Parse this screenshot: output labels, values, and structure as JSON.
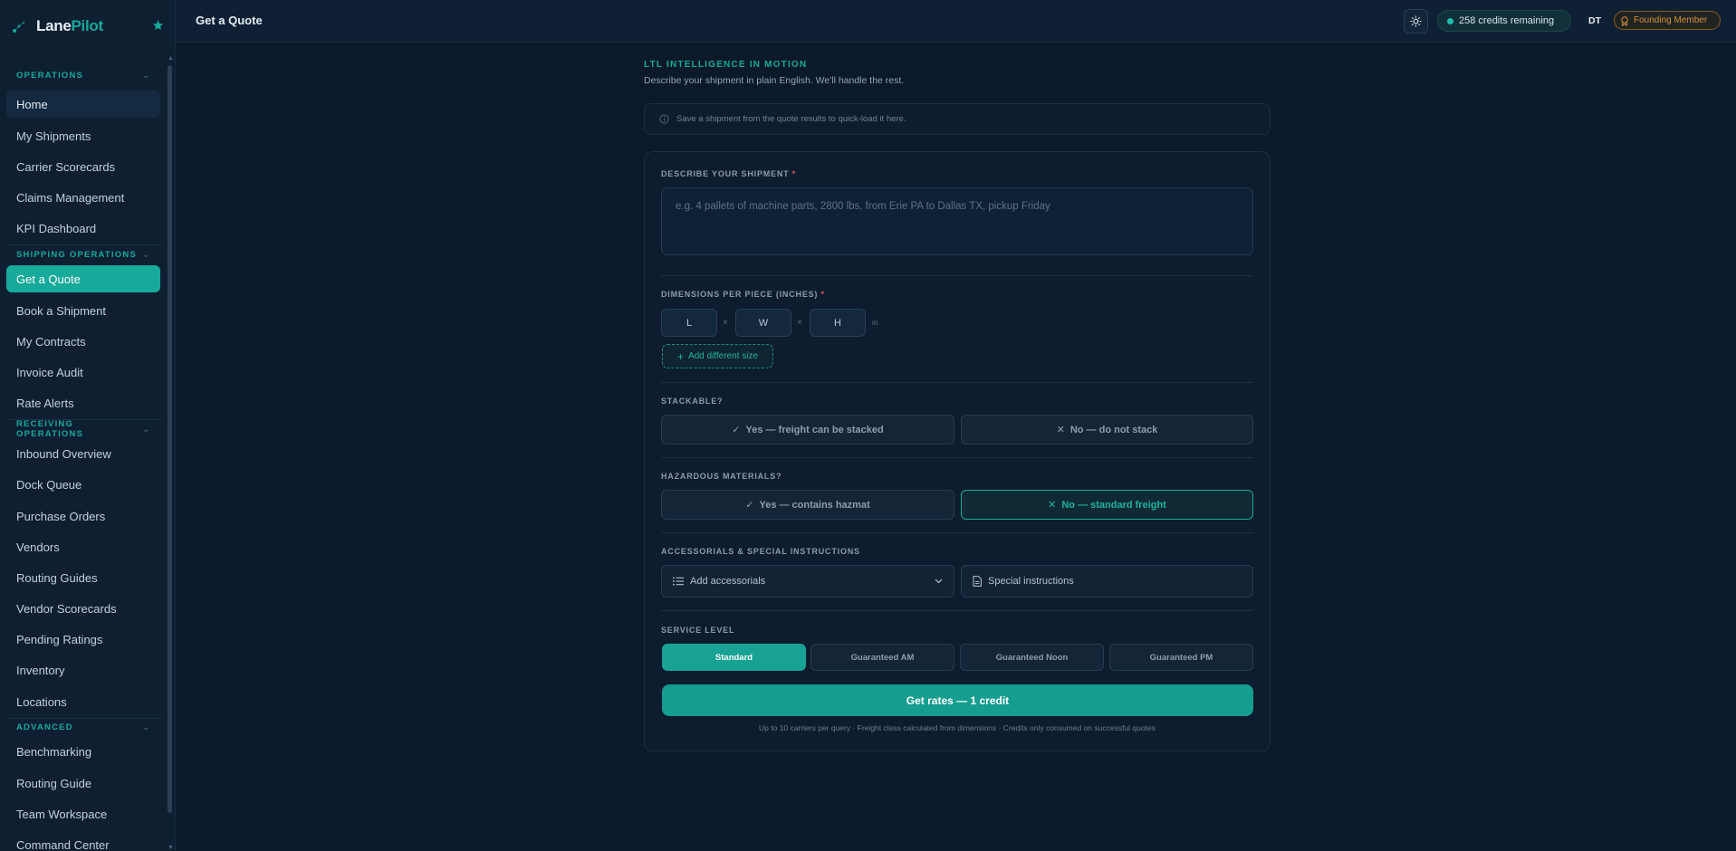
{
  "brand": {
    "name_part1": "Lane",
    "name_part2": "Pilot",
    "accent": "#17a99a"
  },
  "sidebar": {
    "sections": [
      {
        "label": "OPERATIONS"
      },
      {
        "label": "SHIPPING OPERATIONS"
      },
      {
        "label": "RECEIVING OPERATIONS"
      },
      {
        "label": "ADVANCED"
      }
    ],
    "items": [
      {
        "label": "Home"
      },
      {
        "label": "My Shipments"
      },
      {
        "label": "Carrier Scorecards"
      },
      {
        "label": "Claims Management"
      },
      {
        "label": "KPI Dashboard"
      },
      {
        "label": "Get a Quote"
      },
      {
        "label": "Book a Shipment"
      },
      {
        "label": "My Contracts"
      },
      {
        "label": "Invoice Audit"
      },
      {
        "label": "Rate Alerts"
      },
      {
        "label": "Inbound Overview"
      },
      {
        "label": "Dock Queue"
      },
      {
        "label": "Purchase Orders"
      },
      {
        "label": "Vendors"
      },
      {
        "label": "Routing Guides"
      },
      {
        "label": "Vendor Scorecards"
      },
      {
        "label": "Pending Ratings"
      },
      {
        "label": "Inventory"
      },
      {
        "label": "Locations"
      },
      {
        "label": "Benchmarking"
      },
      {
        "label": "Routing Guide"
      },
      {
        "label": "Team Workspace"
      },
      {
        "label": "Command Center"
      }
    ],
    "active_item": "Get a Quote"
  },
  "header": {
    "title": "Get a Quote",
    "credits": "258 credits remaining",
    "user_initials": "DT",
    "member_badge": "Founding Member"
  },
  "hero": {
    "kicker": "LTL INTELLIGENCE IN MOTION",
    "subtitle": "Describe your shipment in plain English. We'll handle the rest."
  },
  "saved_hint": "Save a shipment from the quote results to quick-load it here.",
  "form": {
    "describe_label": "DESCRIBE YOUR SHIPMENT",
    "required_mark": "*",
    "describe_placeholder": "e.g. 4 pallets of machine parts, 2800 lbs, from Erie PA to Dallas TX, pickup Friday",
    "dimensions_label": "DIMENSIONS PER PIECE (INCHES)",
    "dim_l": "L",
    "dim_w": "W",
    "dim_h": "H",
    "dim_separator": "×",
    "dim_unit": "in",
    "add_size": "Add different size",
    "stackable_label": "STACKABLE?",
    "stack_yes": "Yes — freight can be stacked",
    "stack_no": "No — do not stack",
    "hazmat_label": "HAZARDOUS MATERIALS?",
    "hazmat_yes": "Yes — contains hazmat",
    "hazmat_no": "No — standard freight",
    "hazmat_selected": "No — standard freight",
    "accessorials_label": "ACCESSORIALS & SPECIAL INSTRUCTIONS",
    "accessorials_select": "Add accessorials",
    "special_instructions": "Special instructions",
    "service_label": "SERVICE LEVEL",
    "service_options": [
      "Standard",
      "Guaranteed AM",
      "Guaranteed Noon",
      "Guaranteed PM"
    ],
    "service_selected": "Standard",
    "cta": "Get rates — 1 credit",
    "footnote": "Up to 10 carriers per query · Freight class calculated from dimensions · Credits only consumed on successful quotes"
  }
}
